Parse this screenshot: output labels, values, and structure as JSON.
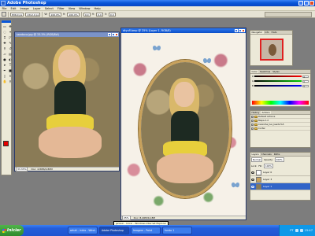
{
  "window": {
    "title": "Adobe Photoshop"
  },
  "menu": [
    "File",
    "Edit",
    "Image",
    "Layer",
    "Select",
    "Filter",
    "View",
    "Window",
    "Help"
  ],
  "options": {
    "width_label": "W:",
    "width_value": "100.0%",
    "height_label": "H:",
    "height_value": "100.0%",
    "x_value": "836.0 px",
    "y_value": "1312.0 px",
    "angle_value": "0.0",
    "h_label": "H:",
    "v_label": "V:"
  },
  "docs": {
    "left": {
      "title": "sandoca.jpg @ 33.3% (RGB/8#)",
      "zoom": "33.33%",
      "info": "Doc: 4,80M/4,80M"
    },
    "right": {
      "title": "dtyufl.bmp @ 25% (Layer 1, RGB/8)",
      "zoom": "25%",
      "info": "Doc: 8,46M/12,8M"
    }
  },
  "panels": {
    "navigator": {
      "tabs": [
        "Navigator",
        "Info",
        "Histo"
      ]
    },
    "color": {
      "tabs": [
        "Color",
        "Swatches",
        "Styles"
      ],
      "rows": [
        {
          "label": "R",
          "value": "0"
        },
        {
          "label": "G",
          "value": "0"
        },
        {
          "label": "B",
          "value": "0"
        }
      ]
    },
    "history": {
      "tabs": [
        "History",
        "Actions"
      ],
      "rows": [
        {
          "label": "Default Actions",
          "kind": "folder"
        },
        {
          "label": "Mapa A 2",
          "kind": "folder"
        },
        {
          "label": "Caixinha_tuo_lsentu%5",
          "kind": "folder"
        },
        {
          "label": "Cortar",
          "kind": "folder"
        }
      ]
    },
    "layers": {
      "tabs": [
        "Layers",
        "Channels",
        "Paths"
      ],
      "mode": "Normal",
      "opacity_label": "Opacity:",
      "opacity_value": "100%",
      "lock_label": "Lock:",
      "fill_label": "Fill:",
      "fill_value": "100%",
      "rows": [
        {
          "name": "Layer 0",
          "selected": false
        },
        {
          "name": "Layer 3",
          "selected": false
        },
        {
          "name": "Layer 1",
          "selected": true
        }
      ]
    }
  },
  "tooltip": "jerivun - Inicio - Windows Internet Explorer",
  "taskbar": {
    "start_label": "Iniciar",
    "items": [
      {
        "label": "artuti - inicio - Wind...",
        "active": false
      },
      {
        "label": "Adobe Photoshop",
        "active": true
      },
      {
        "label": "Imagem - Paint",
        "active": false
      },
      {
        "label": "fundo 1",
        "active": false
      }
    ],
    "lang": "PT",
    "clock": "15:47"
  },
  "colors": {
    "foreground": "#e60000",
    "background": "#ffffff",
    "taskbar": "#245edb",
    "selection": "#3164c8"
  }
}
